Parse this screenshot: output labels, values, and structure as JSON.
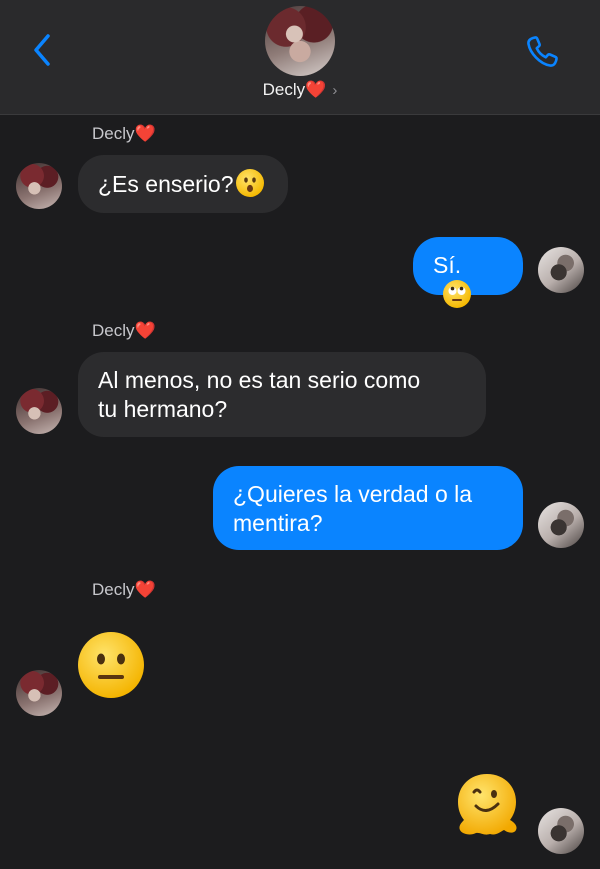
{
  "header": {
    "contact_name": "Decly",
    "heart": "❤️",
    "chevron": "›",
    "accent_color": "#0a84ff"
  },
  "messages": [
    {
      "from": "them",
      "sender": "Decly",
      "text": "¿Es enserio?",
      "emoji": "hushed-face"
    },
    {
      "from": "me",
      "text": "Sí.",
      "emoji": "face-with-rolling-eyes"
    },
    {
      "from": "them",
      "sender": "Decly",
      "text": "Al menos, no es tan serio como tu hermano?"
    },
    {
      "from": "me",
      "text": "¿Quieres la verdad o la mentira?"
    },
    {
      "from": "them",
      "sender": "Decly",
      "emoji": "neutral-face"
    },
    {
      "from": "me",
      "emoji": "melting-face"
    }
  ],
  "lines": {
    "m2_line1": "Al menos, no es tan serio como",
    "m2_line2": "tu hermano?",
    "m3_line1": "¿Quieres la verdad o la",
    "m3_line2": "mentira?"
  }
}
